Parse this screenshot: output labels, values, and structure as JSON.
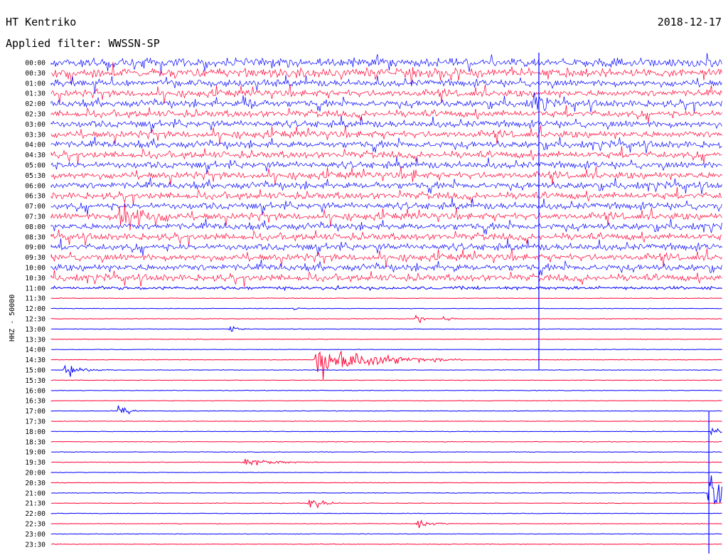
{
  "header": {
    "station": "HT Kentriko",
    "date": "2018-12-17",
    "filter_label": "Applied filter: WWSSN-SP"
  },
  "colors": {
    "trace_a": "#0000ff",
    "trace_b": "#ff0033",
    "marker": "#0000ff"
  },
  "chart_data": {
    "type": "line",
    "title": "",
    "ylabel": "HHZ - 50000",
    "rows": [
      "00:00",
      "00:30",
      "01:00",
      "01:30",
      "02:00",
      "02:30",
      "03:00",
      "03:30",
      "04:00",
      "04:30",
      "05:00",
      "05:30",
      "06:00",
      "06:30",
      "07:00",
      "07:30",
      "08:00",
      "08:30",
      "09:00",
      "09:30",
      "10:00",
      "10:30",
      "11:00",
      "11:30",
      "12:00",
      "12:30",
      "13:00",
      "13:30",
      "14:00",
      "14:30",
      "15:00",
      "15:30",
      "16:00",
      "16:30",
      "17:00",
      "17:30",
      "18:00",
      "18:30",
      "19:00",
      "19:30",
      "20:00",
      "20:30",
      "21:00",
      "21:30",
      "22:00",
      "22:30",
      "23:00",
      "23:30"
    ],
    "row_duration_min": 30,
    "noise_level": [
      4,
      4,
      3,
      3,
      3,
      3,
      3,
      3,
      3,
      3,
      3,
      3,
      3,
      3,
      3,
      3,
      3,
      3,
      3,
      3,
      3,
      3,
      1.5,
      0.3,
      0.3,
      0.3,
      0.3,
      0.3,
      0.3,
      0.3,
      0.3,
      0.3,
      0.3,
      0.3,
      0.3,
      0.3,
      0.3,
      0.3,
      0.3,
      0.3,
      0.3,
      0.3,
      0.3,
      0.3,
      0.3,
      0.3,
      0.3,
      0.3
    ],
    "events": [
      {
        "row": "02:00",
        "t_min": 8.5,
        "amp": 10,
        "dur_min": 1.2
      },
      {
        "row": "02:00",
        "t_min": 21.5,
        "amp": 18,
        "dur_min": 0.6
      },
      {
        "row": "05:30",
        "t_min": 16,
        "amp": 9,
        "dur_min": 0.6
      },
      {
        "row": "06:00",
        "t_min": 14.5,
        "amp": 5,
        "dur_min": 0.6
      },
      {
        "row": "07:30",
        "t_min": 3,
        "amp": 20,
        "dur_min": 1.6
      },
      {
        "row": "10:00",
        "t_min": 18,
        "amp": 6,
        "dur_min": 0.3
      },
      {
        "row": "11:00",
        "t_min": 12.5,
        "amp": 5,
        "dur_min": 0.4
      },
      {
        "row": "12:00",
        "t_min": 10.8,
        "amp": 3,
        "dur_min": 0.2
      },
      {
        "row": "12:30",
        "t_min": 16.3,
        "amp": 6,
        "dur_min": 0.3
      },
      {
        "row": "12:30",
        "t_min": 17.5,
        "amp": 4,
        "dur_min": 0.3
      },
      {
        "row": "13:00",
        "t_min": 8,
        "amp": 4,
        "dur_min": 0.3
      },
      {
        "row": "14:30",
        "t_min": 11.8,
        "amp": 18,
        "dur_min": 2.2
      },
      {
        "row": "15:00",
        "t_min": 0.6,
        "amp": 7,
        "dur_min": 0.8
      },
      {
        "row": "17:00",
        "t_min": 3,
        "amp": 6,
        "dur_min": 0.5
      },
      {
        "row": "18:00",
        "t_min": 29.5,
        "amp": 5,
        "dur_min": 0.4
      },
      {
        "row": "19:30",
        "t_min": 8.5,
        "amp": 4,
        "dur_min": 1.6
      },
      {
        "row": "21:00",
        "t_min": 29.4,
        "amp": 22,
        "dur_min": 1.2
      },
      {
        "row": "21:30",
        "t_min": 11.5,
        "amp": 8,
        "dur_min": 0.5
      },
      {
        "row": "22:30",
        "t_min": 16.3,
        "amp": 4,
        "dur_min": 0.7
      }
    ],
    "vertical_spikes": [
      {
        "t_min": 21.8,
        "from_row": "00:00",
        "to_row": "14:30"
      },
      {
        "t_min": 29.4,
        "from_row": "17:30",
        "to_row": "23:30"
      }
    ]
  }
}
